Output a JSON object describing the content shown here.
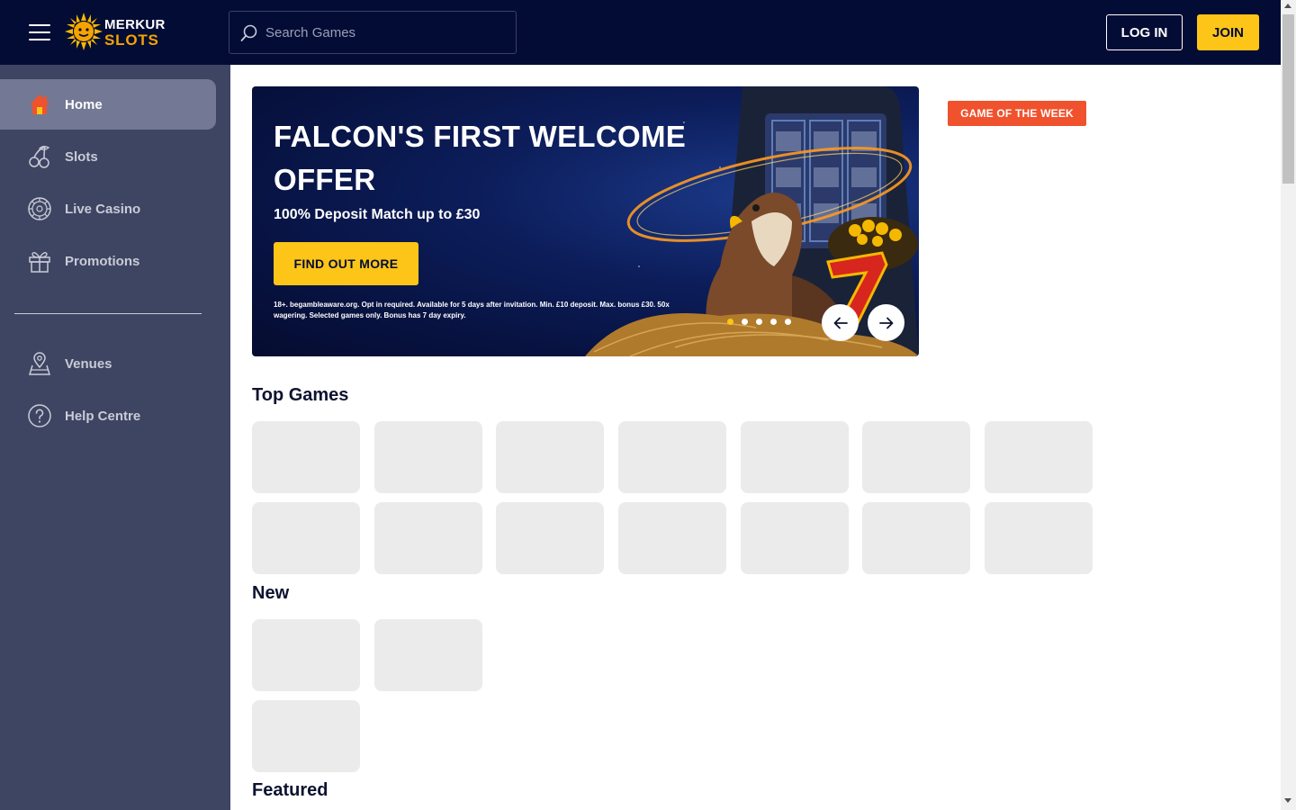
{
  "header": {
    "logo_line1": "MERKUR",
    "logo_line2": "SLOTS",
    "search_placeholder": "Search Games",
    "login_label": "LOG IN",
    "join_label": "JOIN"
  },
  "sidebar": {
    "items": [
      {
        "label": "Home",
        "icon": "home-icon",
        "active": true
      },
      {
        "label": "Slots",
        "icon": "cherries-icon"
      },
      {
        "label": "Live Casino",
        "icon": "roulette-wheel-icon"
      },
      {
        "label": "Promotions",
        "icon": "gift-icon"
      }
    ],
    "secondary_items": [
      {
        "label": "Venues",
        "icon": "map-pin-icon"
      },
      {
        "label": "Help Centre",
        "icon": "help-circle-icon"
      }
    ]
  },
  "banner": {
    "title": "FALCON'S FIRST WELCOME OFFER",
    "subtitle": "100% Deposit Match up to £30",
    "cta_label": "FIND OUT MORE",
    "terms": "18+. begambleaware.org. Opt in required. Available for 5 days after invitation. Min. £10 deposit. Max. bonus £30. 50x wagering. Selected games only. Bonus has 7 day expiry.",
    "slide_count": 5,
    "active_slide": 1
  },
  "game_of_the_week": {
    "label": "GAME OF THE WEEK"
  },
  "sections": [
    {
      "title": "Top Games",
      "tile_count": 14
    },
    {
      "title": "New",
      "tile_count": 3
    },
    {
      "title": "Featured"
    }
  ],
  "colors": {
    "header_bg": "#030c35",
    "sidebar_bg": "#3e4563",
    "accent_yellow": "#fcc517",
    "badge_orange": "#f0522e",
    "placeholder_tile": "#ebebeb"
  }
}
